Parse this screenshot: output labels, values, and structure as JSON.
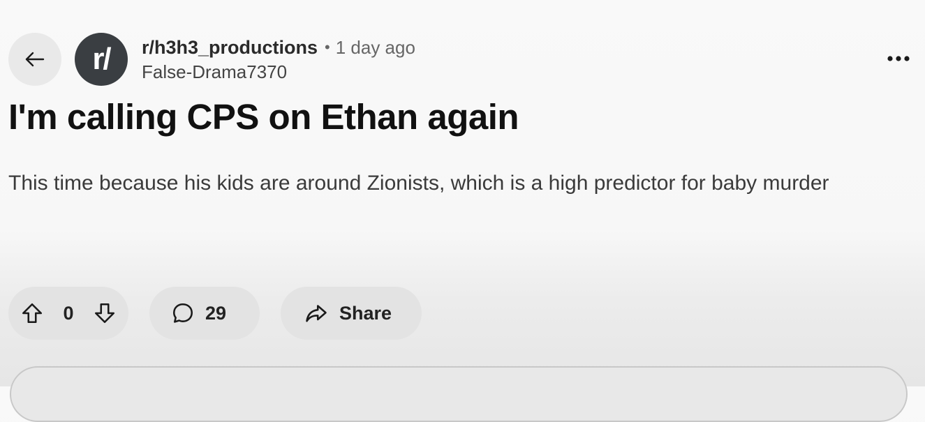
{
  "header": {
    "subreddit": "r/h3h3_productions",
    "separator": "•",
    "time_ago": "1 day ago",
    "author": "False-Drama7370",
    "avatar_text": "r/"
  },
  "post": {
    "title": "I'm calling CPS on Ethan again",
    "body": "This time because his kids are around Zionists, which is a high predictor for baby murder"
  },
  "actions": {
    "vote_count": "0",
    "comment_count": "29",
    "share_label": "Share"
  },
  "icons": {
    "back": "arrow-left-icon",
    "more": "more-horizontal-icon",
    "upvote": "arrow-up-icon",
    "downvote": "arrow-down-icon",
    "comment": "comment-bubble-icon",
    "share": "share-arrow-icon"
  },
  "colors": {
    "background": "#f8f8f8",
    "pill": "#e3e3e3",
    "avatar": "#3a3e42",
    "text": "#1a1a1a"
  }
}
